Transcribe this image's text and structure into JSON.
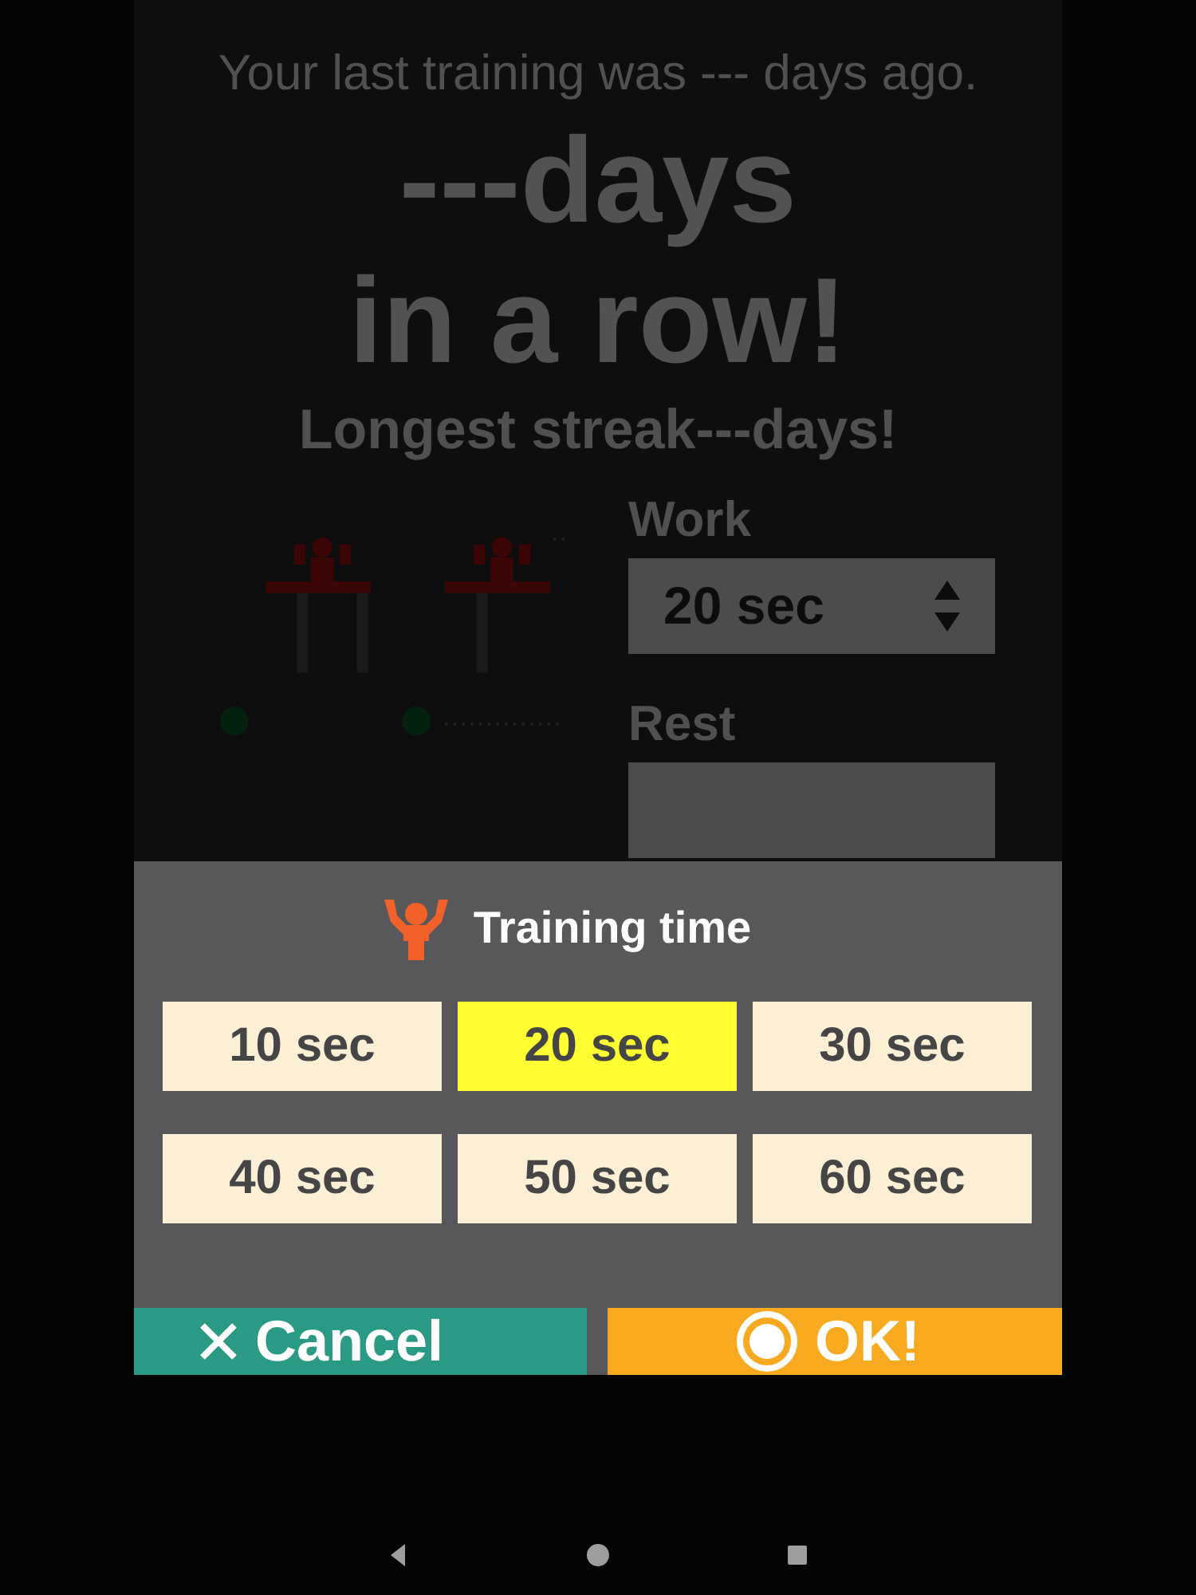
{
  "background": {
    "last_training": "Your last training was --- days ago.",
    "streak_line1": "---days",
    "streak_line2": "in a row!",
    "longest": "Longest streak---days!",
    "work_label": "Work",
    "work_value": "20 sec",
    "rest_label": "Rest"
  },
  "dialog": {
    "title": "Training time",
    "options": [
      {
        "label": "10 sec",
        "selected": false
      },
      {
        "label": "20 sec",
        "selected": true
      },
      {
        "label": "30 sec",
        "selected": false
      },
      {
        "label": "40 sec",
        "selected": false
      },
      {
        "label": "50 sec",
        "selected": false
      },
      {
        "label": "60 sec",
        "selected": false
      }
    ],
    "cancel": "Cancel",
    "ok": "OK!"
  }
}
